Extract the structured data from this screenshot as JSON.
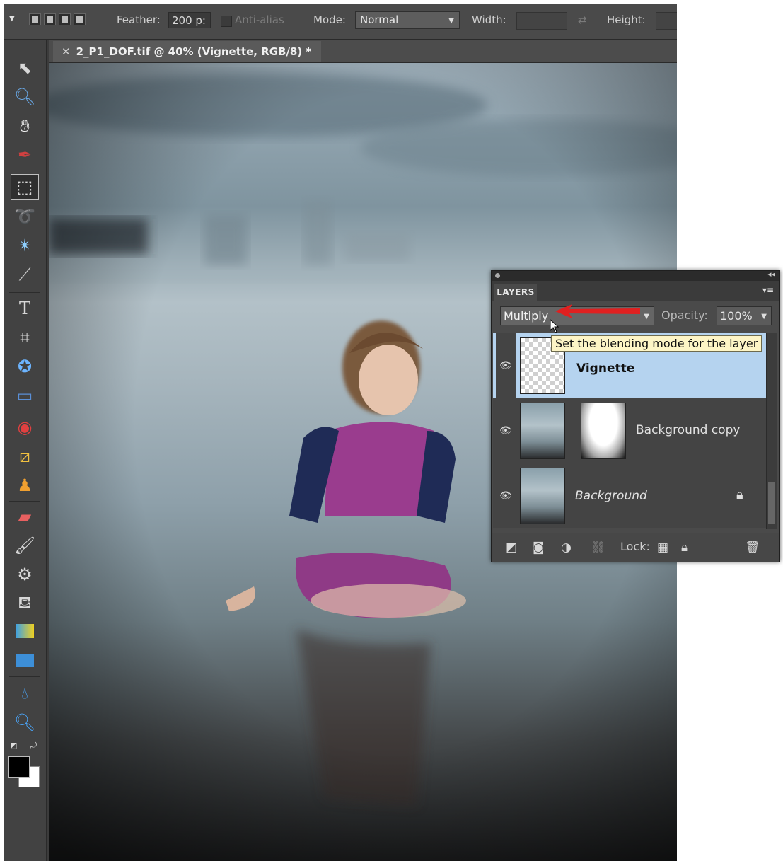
{
  "options_bar": {
    "feather_label": "Feather:",
    "feather_value": "200 p:",
    "anti_alias_label": "Anti-alias",
    "mode_label": "Mode:",
    "mode_value": "Normal",
    "width_label": "Width:",
    "height_label": "Height:"
  },
  "document": {
    "tab_close": "✕",
    "tab_title": "2_P1_DOF.tif @ 40% (Vignette, RGB/8) *"
  },
  "toolbar": {
    "tools": [
      "move-tool",
      "zoom-tool",
      "hand-tool",
      "eyedropper-tool",
      "rectangular-marquee-tool",
      "lasso-tool",
      "magic-wand-tool",
      "quick-selection-tool",
      "type-tool",
      "crop-tool",
      "cookie-cutter-tool",
      "straighten-tool",
      "red-eye-tool",
      "spot-healing-tool",
      "clone-stamp-tool",
      "eraser-tool",
      "brush-tool",
      "smart-brush-tool",
      "paint-bucket-tool",
      "gradient-tool",
      "shape-tool",
      "blur-tool",
      "sponge-tool"
    ],
    "selected_tool": "rectangular-marquee-tool",
    "foreground_color": "#000000",
    "background_color": "#ffffff"
  },
  "layers_panel": {
    "tab_label": "LAYERS",
    "blend_mode": "Multiply",
    "opacity_label": "Opacity:",
    "opacity_value": "100%",
    "tooltip": "Set the blending mode for the layer",
    "layers": [
      {
        "name": "Vignette",
        "active": true
      },
      {
        "name": "Background copy",
        "active": false
      },
      {
        "name": "Background",
        "active": false,
        "locked": true
      }
    ],
    "lock_label": "Lock:"
  },
  "colors": {
    "active_layer": "#b5d3ef",
    "annotation_arrow": "#e02020",
    "tooltip_bg": "#fdf5c6"
  }
}
